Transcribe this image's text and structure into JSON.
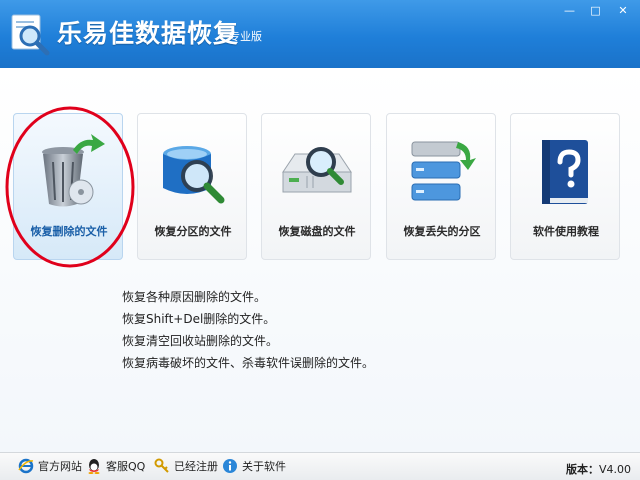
{
  "app": {
    "title": "乐易佳数据恢复",
    "edition": "专业版"
  },
  "window_controls": {
    "minimize": "—",
    "maximize": "□",
    "close": "✕"
  },
  "features": [
    {
      "label": "恢复删除的文件",
      "icon": "recycle-bin-icon",
      "selected": true
    },
    {
      "label": "恢复分区的文件",
      "icon": "partition-search-icon",
      "selected": false
    },
    {
      "label": "恢复磁盘的文件",
      "icon": "disk-search-icon",
      "selected": false
    },
    {
      "label": "恢复丢失的分区",
      "icon": "lost-partition-icon",
      "selected": false
    },
    {
      "label": "软件使用教程",
      "icon": "help-book-icon",
      "selected": false
    }
  ],
  "description": [
    "恢复各种原因删除的文件。",
    "恢复Shift+Del删除的文件。",
    "恢复清空回收站删除的文件。",
    "恢复病毒破坏的文件、杀毒软件误删除的文件。"
  ],
  "footer": {
    "links": [
      {
        "label": "官方网站",
        "icon": "ie-icon"
      },
      {
        "label": "客服QQ",
        "icon": "qq-icon"
      },
      {
        "label": "已经注册",
        "icon": "key-icon"
      },
      {
        "label": "关于软件",
        "icon": "info-icon"
      }
    ],
    "version_label": "版本：",
    "version_value": "V4.00"
  },
  "colors": {
    "titlebar": "#1f7fd9",
    "accent": "#1a5fa8",
    "highlight_circle": "#e0001b"
  }
}
